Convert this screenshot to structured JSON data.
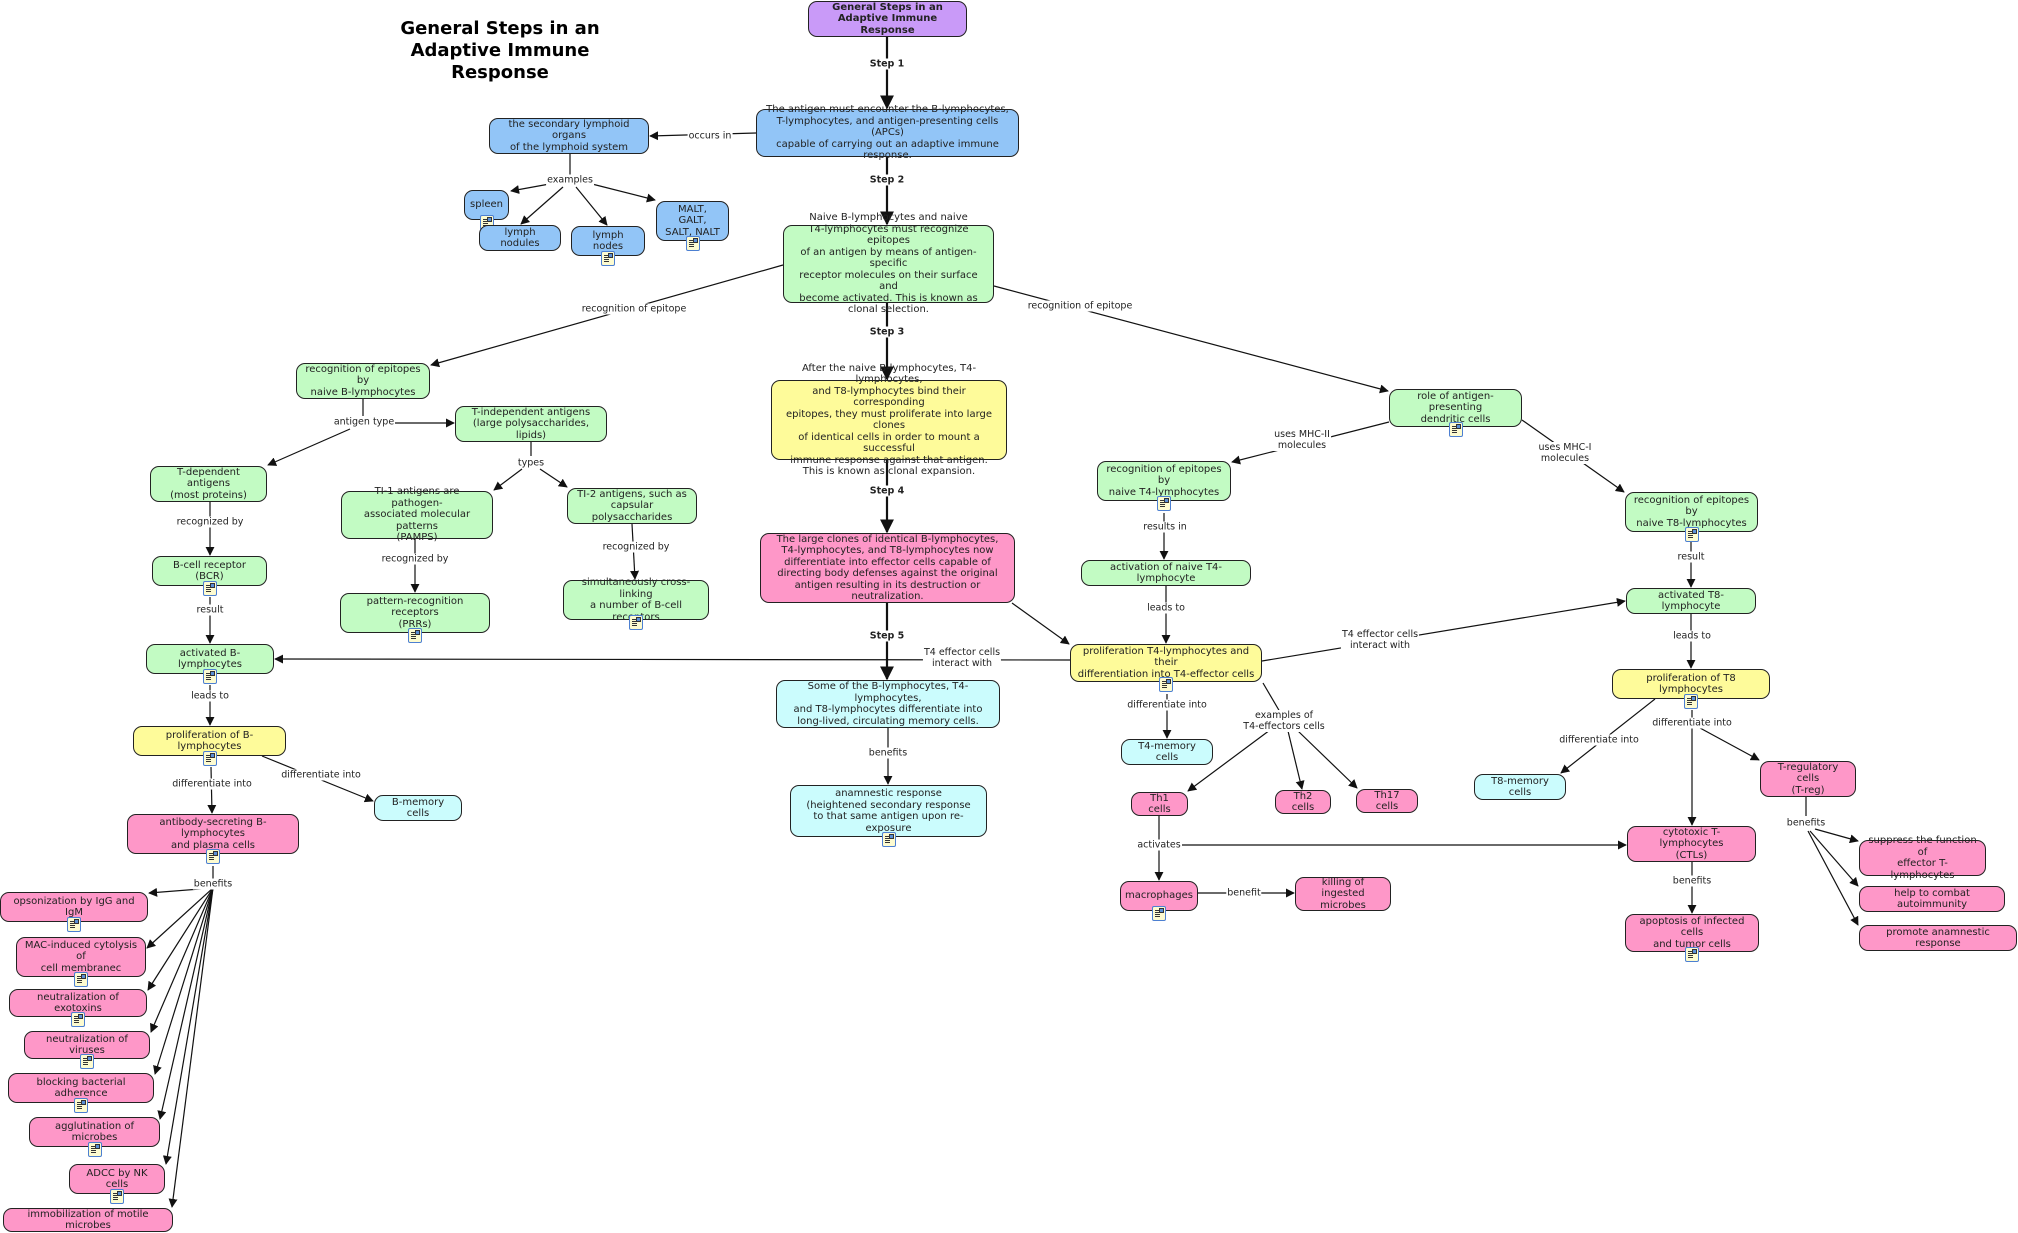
{
  "title": "General Steps in an\nAdaptive Immune Response",
  "colors": {
    "blue": "#92c5f7",
    "green": "#c2fbc3",
    "yellow": "#fefb9a",
    "pink": "#fe97c8",
    "cyan": "#cbfcfd",
    "purple": "#c99af8",
    "line": "#111111"
  },
  "nodes": {
    "root": "General Steps in an\nAdaptive Immune Response",
    "step1": "The antigen must encounter the B-lymphocytes,\nT-lymphocytes, and antigen-presenting cells (APCs)\ncapable of carrying out an adaptive immune response.",
    "lymphoid_organs": "the secondary lymphoid organs\nof the lymphoid system",
    "spleen": "spleen",
    "lymph_nodules": "lymph nodules",
    "lymph_nodes": "lymph nodes",
    "malt": "MALT, GALT,\nSALT, NALT",
    "step2": "Naive B-lymphocytes and naive\nT4-lymphocytes must recognize epitopes\nof an antigen by means of antigen-specific\nreceptor molecules on their surface and\nbecome activated. This is known as\nclonal selection.",
    "step3": "After the naive B-lymphocytes, T4-lymphocytes,\nand T8-lymphocytes bind their corresponding\nepitopes, they must proliferate into large clones\nof identical cells in order to mount a successful\nimmune response against that antigen.\nThis is known as clonal expansion.",
    "step4": "The large clones of identical B-lymphocytes,\nT4-lymphocytes, and T8-lymphocytes now\ndifferentiate into effector cells capable of\ndirecting body defenses against the original\nantigen resulting in its destruction or neutralization.",
    "step5": "Some of the B-lymphocytes, T4-lymphocytes,\nand T8-lymphocytes differentiate into\nlong-lived, circulating memory cells.",
    "anamnestic": "anamnestic response\n(heightened secondary response\nto that same antigen upon re-exposure",
    "recog_b": "recognition of epitopes by\nnaive B-lymphocytes",
    "t_independent": "T-independent antigens\n(large polysaccharides, lipids)",
    "t_dependent": "T-dependent antigens\n(most proteins)",
    "ti1": "TI-1 antigens are pathogen-\nassociated molecular patterns\n(PAMPS)",
    "ti2": "TI-2 antigens, such as\ncapsular polysaccharides",
    "prr": "pattern-recognition receptors\n(PRRs)",
    "crosslink": "simultaneously cross-linking\na number of B-cell receptors",
    "bcr": "B-cell receptor (BCR)",
    "activated_b": "activated B-lymphocytes",
    "prolif_b": "proliferation of B-lymphocytes",
    "b_memory": "B-memory cells",
    "antibody": "antibody-secreting B-lymphocytes\nand plasma cells",
    "opsonization": "opsonization by IgG and IgM",
    "mac": "MAC-induced cytolysis of\ncell membranec",
    "exotoxins": "neutralization of exotoxins",
    "viruses": "neutralization of viruses",
    "blocking": "blocking bacterial adherence",
    "agglutination": "agglutination of microbes",
    "adcc": "ADCC by NK cells",
    "immobilization": "immobilization of motile microbes",
    "dendritic": "role of antigen-presenting\ndendritic cells",
    "recog_t4": "recognition of epitopes by\nnaive T4-lymphocytes",
    "activation_t4": "activation of naive T4-lymphocyte",
    "prolif_t4": "proliferation T4-lymphocytes and their\ndifferentiation into T4-effector cells",
    "t4_memory": "T4-memory cells",
    "th1": "Th1 cells",
    "th2": "Th2 cells",
    "th17": "Th17 cells",
    "macrophages": "macrophages",
    "killing": "killing of ingested\nmicrobes",
    "recog_t8": "recognition of epitopes by\nnaive T8-lymphocytes",
    "activated_t8": "activated T8-lymphocyte",
    "prolif_t8": "proliferation of T8 lymphocytes",
    "t8_memory": "T8-memory cells",
    "treg": "T-regulatory cells\n(T-reg)",
    "ctl": "cytotoxic T-lymphocytes\n(CTLs)",
    "apoptosis": "apoptosis of infected cells\nand tumor cells",
    "suppress": "suppress the function of\neffector T-lymphocytes",
    "autoimmunity": "help to combat autoimmunity",
    "promote": "promote anamnestic response"
  },
  "links": {
    "step1": "Step 1",
    "step2": "Step 2",
    "step3": "Step 3",
    "step4": "Step 4",
    "step5": "Step 5",
    "occurs_in": "occurs in",
    "examples": "examples",
    "recog_epitope_left": "recognition of epitope",
    "recog_epitope_right": "recognition of epitope",
    "antigen_type": "antigen type",
    "types": "types",
    "recognized_by_1": "recognized by",
    "recognized_by_2": "recognized by",
    "recognized_by_3": "recognized by",
    "result_b": "result",
    "leads_to_b": "leads to",
    "diff_into_b1": "differentiate into",
    "diff_into_b2": "differentiate into",
    "benefits_b": "benefits",
    "t4_interact_left": "T4 effector cells\ninteract with",
    "t4_interact_right": "T4 effector cells\ninteract with",
    "benefits_mem": "benefits",
    "mhc2": "uses MHC-II\nmolecules",
    "mhc1": "uses MHC-I\nmolecules",
    "results_in": "results in",
    "leads_to_t4": "leads to",
    "diff_into_t4": "differentiate into",
    "examples_t4": "examples of\nT4-effectors cells",
    "activates": "activates",
    "benefit_mac": "benefit",
    "result_t8": "result",
    "leads_to_t8": "leads to",
    "diff_into_t8a": "differentiate into",
    "diff_into_t8b": "differentiate into",
    "benefits_ctl": "benefits",
    "benefits_treg": "benefits"
  }
}
